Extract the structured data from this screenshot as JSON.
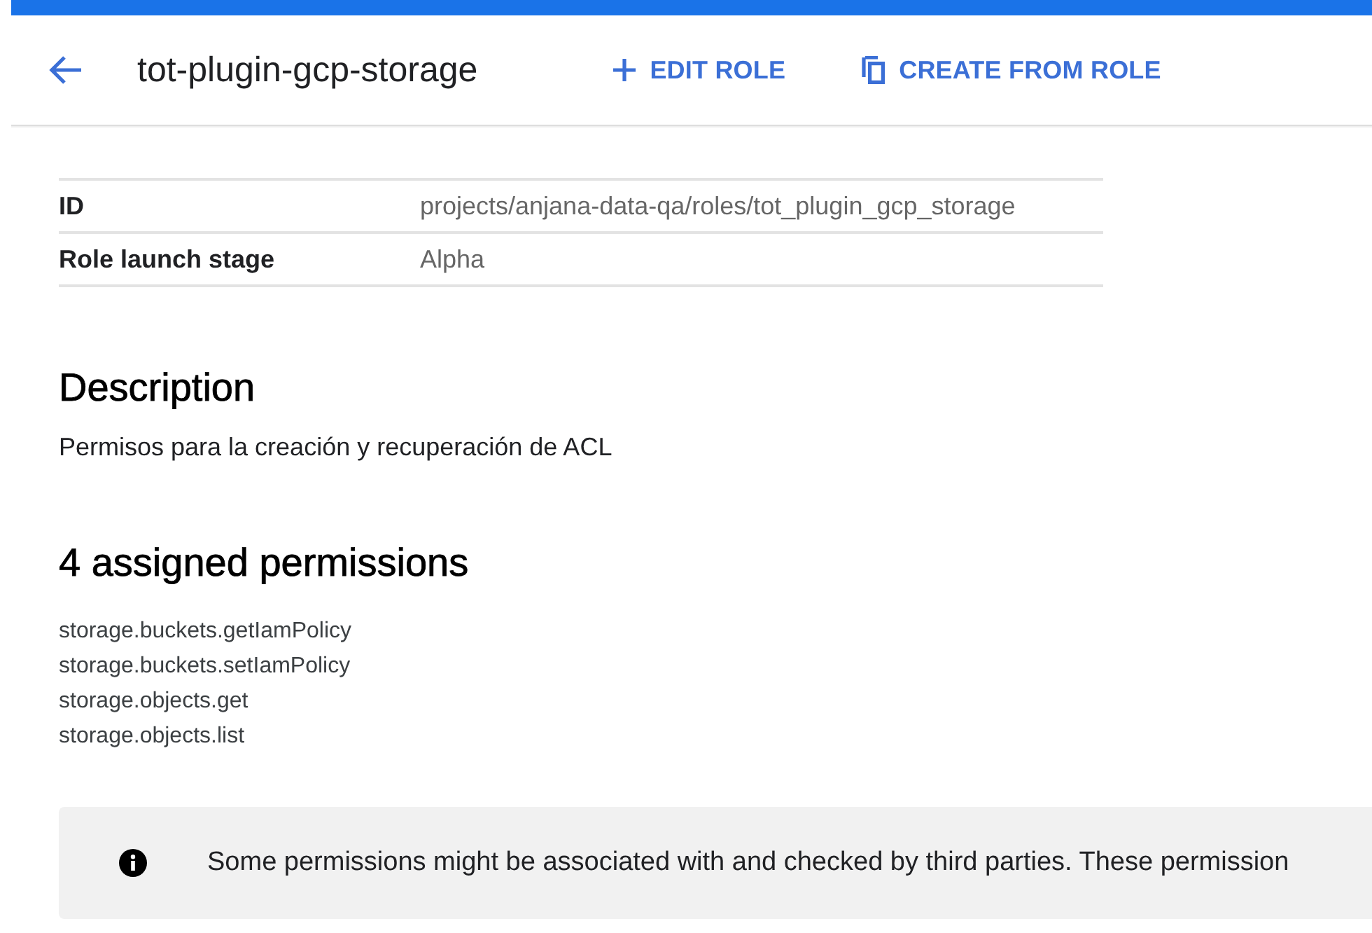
{
  "header": {
    "title": "tot-plugin-gcp-storage",
    "actions": [
      {
        "kind": "edit",
        "label": "EDIT ROLE"
      },
      {
        "kind": "copy",
        "label": "CREATE FROM ROLE"
      }
    ]
  },
  "details": [
    {
      "label": "ID",
      "value": "projects/anjana-data-qa/roles/tot_plugin_gcp_storage"
    },
    {
      "label": "Role launch stage",
      "value": "Alpha"
    }
  ],
  "description": {
    "heading": "Description",
    "text": "Permisos para la creación y recuperación de ACL"
  },
  "permissions": {
    "heading": "4 assigned permissions",
    "items": [
      "storage.buckets.getIamPolicy",
      "storage.buckets.setIamPolicy",
      "storage.objects.get",
      "storage.objects.list"
    ]
  },
  "notice": {
    "text": "Some permissions might be associated with and checked by third parties. These permission"
  }
}
